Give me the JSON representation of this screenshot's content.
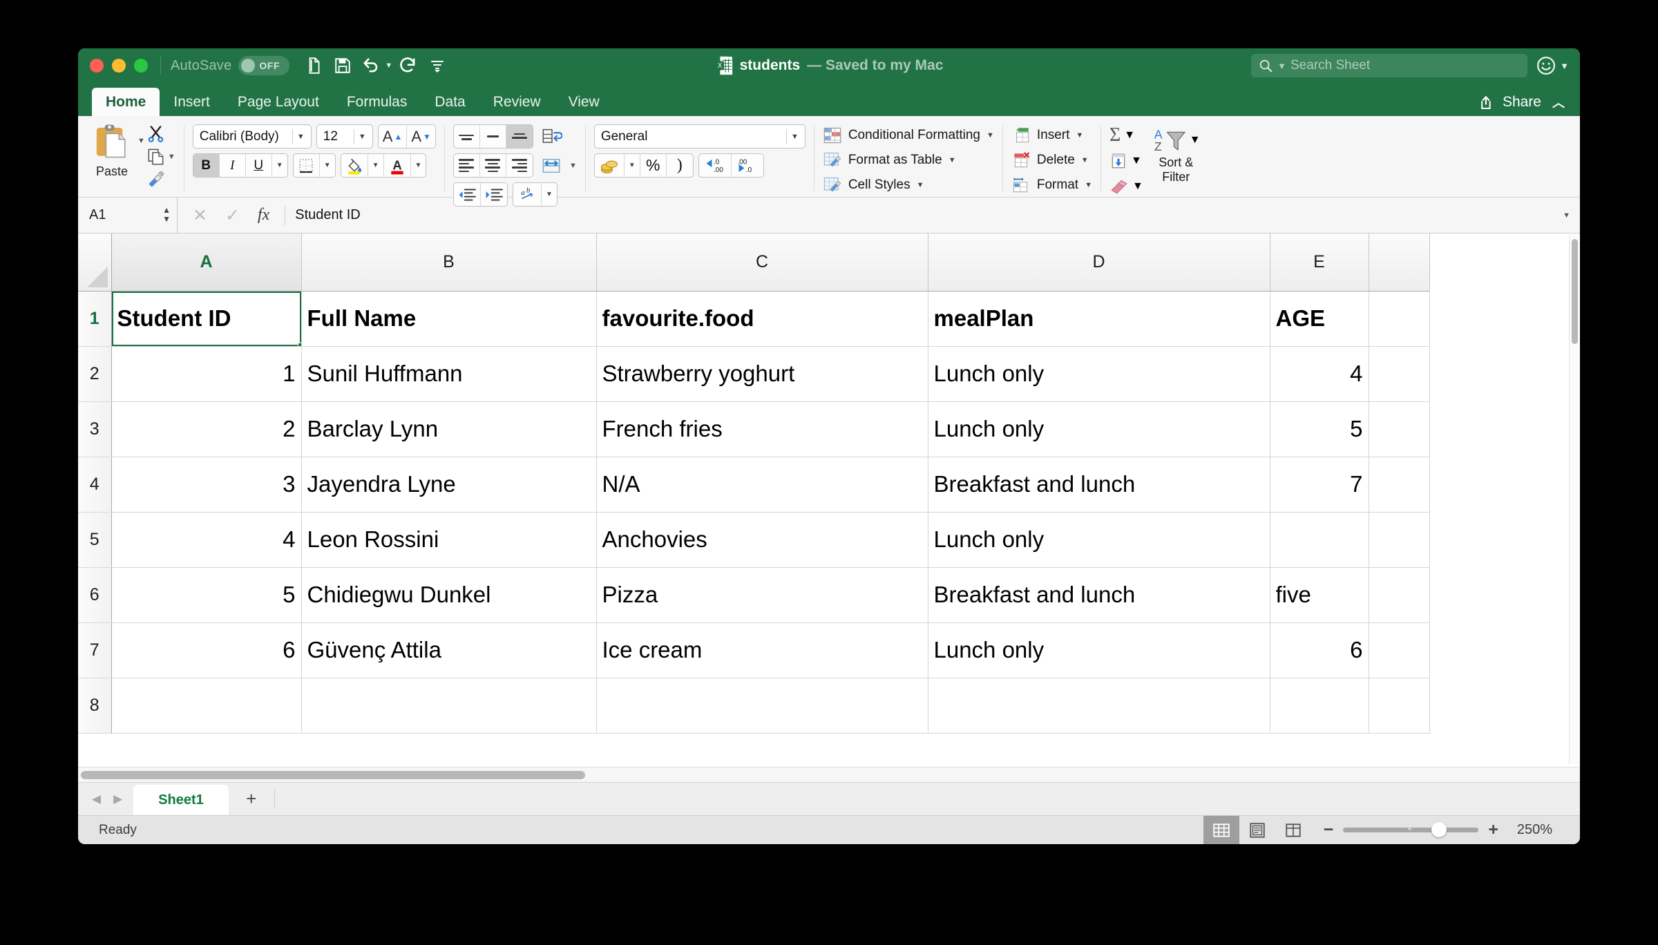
{
  "titlebar": {
    "autosave_label": "AutoSave",
    "autosave_state": "OFF",
    "doc_name": "students",
    "doc_status": "— Saved to my Mac",
    "search_placeholder": "Search Sheet",
    "quick_access": [
      "new-document-icon",
      "save-icon",
      "undo-icon",
      "redo-icon",
      "customize-icon"
    ]
  },
  "ribbon": {
    "tabs": [
      {
        "label": "Home",
        "active": true
      },
      {
        "label": "Insert",
        "active": false
      },
      {
        "label": "Page Layout",
        "active": false
      },
      {
        "label": "Formulas",
        "active": false
      },
      {
        "label": "Data",
        "active": false
      },
      {
        "label": "Review",
        "active": false
      },
      {
        "label": "View",
        "active": false
      }
    ],
    "share_label": "Share",
    "clipboard": {
      "paste_label": "Paste",
      "cut_name": "cut-icon",
      "copy_name": "copy-icon",
      "format_painter_name": "format-painter-icon"
    },
    "font": {
      "family": "Calibri (Body)",
      "size": "12",
      "grow_label": "A",
      "shrink_label": "A",
      "bold_label": "B",
      "italic_label": "I",
      "underline_label": "U",
      "bold_active": true,
      "fill_color": "#ffe600",
      "font_color": "#ee0000"
    },
    "number": {
      "format": "General",
      "percent_label": "%",
      "comma_label": ")",
      "dec_increase": ".00",
      "dec_decrease": ".0"
    },
    "styles": [
      {
        "label": "Conditional Formatting",
        "icon": "conditional-formatting-icon"
      },
      {
        "label": "Format as Table",
        "icon": "format-as-table-icon"
      },
      {
        "label": "Cell Styles",
        "icon": "cell-styles-icon"
      }
    ],
    "cells": [
      {
        "label": "Insert",
        "icon": "insert-cells-icon"
      },
      {
        "label": "Delete",
        "icon": "delete-cells-icon"
      },
      {
        "label": "Format",
        "icon": "format-cells-icon"
      }
    ],
    "editing": {
      "autosum": "Σ",
      "fill_icon": "fill-down-icon",
      "clear_icon": "clear-eraser-icon",
      "sort_filter_line1": "Sort &",
      "sort_filter_line2": "Filter"
    }
  },
  "formulabar": {
    "name_box": "A1",
    "cancel_icon": "cancel-icon",
    "accept_icon": "accept-icon",
    "fx_label": "fx",
    "content": "Student ID"
  },
  "grid": {
    "columns": [
      "A",
      "B",
      "C",
      "D",
      "E",
      ""
    ],
    "selected_column": "A",
    "selected_row": "1",
    "selected_cell": "A1",
    "row_numbers": [
      "1",
      "2",
      "3",
      "4",
      "5",
      "6",
      "7",
      "8"
    ],
    "header_row": [
      "Student ID",
      "Full Name",
      "favourite.food",
      "mealPlan",
      "AGE"
    ],
    "rows": [
      {
        "num": "2",
        "a": "1",
        "b": "Sunil Huffmann",
        "c": "Strawberry yoghurt",
        "d": "Lunch only",
        "e": "4",
        "e_numeric": true
      },
      {
        "num": "3",
        "a": "2",
        "b": "Barclay Lynn",
        "c": "French fries",
        "d": "Lunch only",
        "e": "5",
        "e_numeric": true
      },
      {
        "num": "4",
        "a": "3",
        "b": "Jayendra Lyne",
        "c": "N/A",
        "d": "Breakfast and lunch",
        "e": "7",
        "e_numeric": true
      },
      {
        "num": "5",
        "a": "4",
        "b": "Leon Rossini",
        "c": "Anchovies",
        "d": "Lunch only",
        "e": "",
        "e_numeric": true
      },
      {
        "num": "6",
        "a": "5",
        "b": "Chidiegwu Dunkel",
        "c": "Pizza",
        "d": "Breakfast and lunch",
        "e": "five",
        "e_numeric": false
      },
      {
        "num": "7",
        "a": "6",
        "b": "Güvenç Attila",
        "c": "Ice cream",
        "d": "Lunch only",
        "e": "6",
        "e_numeric": true
      },
      {
        "num": "8",
        "a": "",
        "b": "",
        "c": "",
        "d": "",
        "e": "",
        "e_numeric": true
      }
    ]
  },
  "sheetbar": {
    "prev_icon": "prev-sheet-icon",
    "next_icon": "next-sheet-icon",
    "tabs": [
      {
        "label": "Sheet1",
        "active": true
      }
    ],
    "add_label": "+"
  },
  "statusbar": {
    "status": "Ready",
    "views": [
      {
        "name": "normal-view-icon",
        "active": true
      },
      {
        "name": "page-layout-view-icon",
        "active": false
      },
      {
        "name": "page-break-view-icon",
        "active": false
      }
    ],
    "zoom_out": "−",
    "zoom_in": "+",
    "zoom_level": "250%"
  }
}
